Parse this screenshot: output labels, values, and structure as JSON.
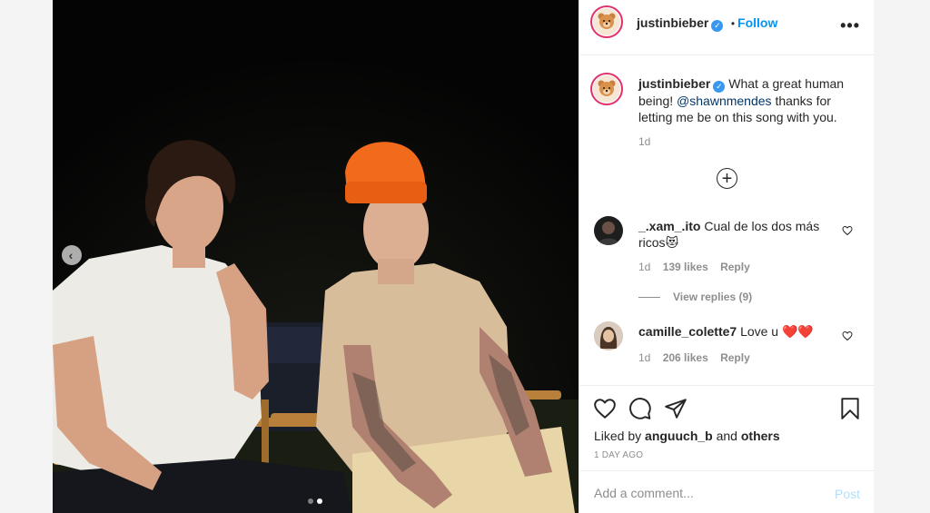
{
  "post": {
    "author": "justinbieber",
    "follow_label": "Follow",
    "more_label": "•••",
    "separator": "•"
  },
  "caption": {
    "author": "justinbieber",
    "text_before": "What a great human being!",
    "mention": "@shawnmendes",
    "text_after": "thanks for letting me be on this song with you.",
    "age": "1d"
  },
  "load_more_icon": "plus-circle-icon",
  "comments": [
    {
      "user": "_.xam_.ito",
      "text": "Cual de los dos más ricos",
      "emoji": "😻",
      "age": "1d",
      "likes": "139 likes",
      "reply_label": "Reply",
      "view_replies": "View replies (9)"
    },
    {
      "user": "camille_colette7",
      "text": "Love u",
      "emoji": "❤️❤️",
      "age": "1d",
      "likes": "206 likes",
      "reply_label": "Reply"
    }
  ],
  "actions": {
    "icons": [
      "heart-icon",
      "comment-icon",
      "share-icon",
      "bookmark-icon"
    ],
    "liked_by_prefix": "Liked by",
    "liked_by_user": "anguuch_b",
    "liked_by_and": "and",
    "liked_by_others": "others",
    "timestamp": "1 DAY AGO"
  },
  "add_comment": {
    "placeholder": "Add a comment...",
    "post_label": "Post"
  },
  "carousel": {
    "slide_count": 2,
    "active_index": 1
  },
  "colors": {
    "link": "#0095f6",
    "mention": "#00376b",
    "muted": "#8e8e8e",
    "post_disabled": "#b2dffc",
    "beanie": "#f26a1b"
  }
}
